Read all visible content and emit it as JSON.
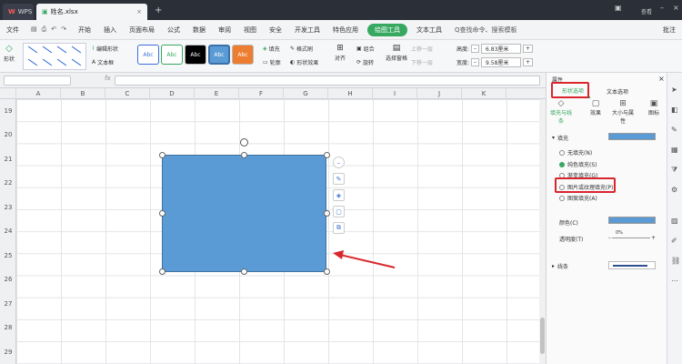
{
  "titlebar": {
    "app_tab": "WPS",
    "file_tab": "姓名.xlsx",
    "plus": "+",
    "user": "查看"
  },
  "menubar": {
    "file": "文件",
    "items": [
      "开始",
      "插入",
      "页面布局",
      "公式",
      "数据",
      "审阅",
      "视图",
      "安全",
      "开发工具",
      "特色应用",
      "绘图工具",
      "文本工具"
    ],
    "active": "绘图工具",
    "search": "Q查找命令、搜索模板",
    "comment": "批注"
  },
  "ribbon": {
    "shape": "形状",
    "edit_shape": "编辑形状",
    "textbox": "文本框",
    "styles": [
      "Abc",
      "Abc",
      "Abc",
      "Abc",
      "Abc"
    ],
    "fill": "填充",
    "format_brush": "格式刷",
    "outline": "轮廓",
    "shape_effect": "形状效果",
    "align": "对齐",
    "group": "组合",
    "rotate": "旋转",
    "select_pane": "选择窗格",
    "up_one": "上移一层",
    "down_one": "下移一层",
    "height_label": "高度:",
    "height_value": "6.83厘米",
    "width_label": "宽度:",
    "width_value": "9.58厘米"
  },
  "formula": {
    "fx": "fx"
  },
  "columns": [
    "A",
    "B",
    "C",
    "D",
    "E",
    "F",
    "G",
    "H",
    "I",
    "J",
    "K"
  ],
  "rows": [
    "19",
    "20",
    "21",
    "22",
    "23",
    "24",
    "25",
    "26",
    "27",
    "28",
    "29"
  ],
  "panel": {
    "title": "属性",
    "tab_shape": "形状选项",
    "tab_text": "文本选项",
    "icons": [
      "填充与线条",
      "效果",
      "大小与属性",
      "图标"
    ],
    "fill_section": "填充",
    "options": [
      "无填充(N)",
      "纯色填充(S)",
      "渐变填充(G)",
      "图片或纹理填充(P)",
      "图案填充(A)"
    ],
    "selected_option": "纯色填充(S)",
    "color_label": "颜色(C)",
    "transparency_label": "透明度(T)",
    "transparency_value": "0%",
    "line_section": "线条",
    "colors": {
      "shape_fill": "#5b9bd5",
      "accent": "#37a85f",
      "highlight": "#d9262c"
    }
  }
}
